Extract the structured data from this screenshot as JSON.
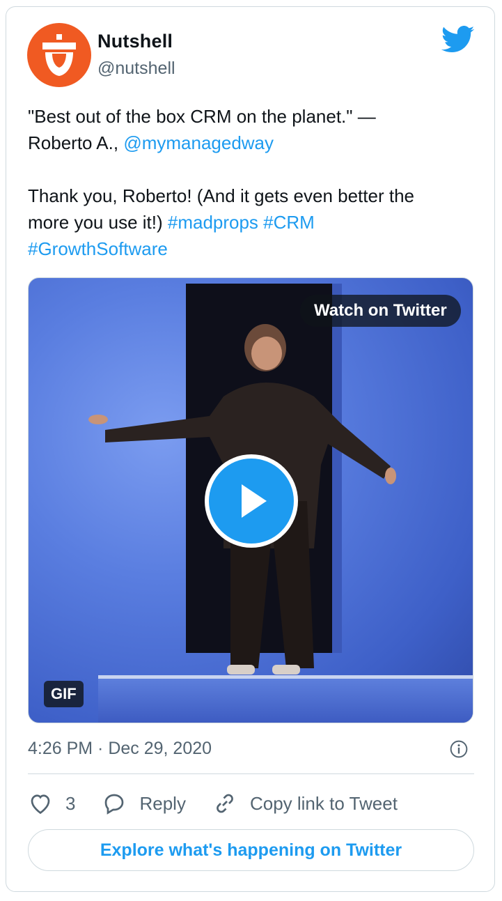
{
  "author": {
    "name": "Nutshell",
    "handle": "@nutshell",
    "avatar_icon": "acorn-logo-icon",
    "avatar_color": "#f05a22"
  },
  "tweet": {
    "line1": "\"Best out of the box CRM on the planet.\" —",
    "line2_prefix": "Roberto A., ",
    "mention": "@mymanagedway",
    "line3": "Thank you, Roberto! (And it gets even better the",
    "line4_prefix": "more you use it!) ",
    "hashtag1": "#madprops",
    "hashtag2": "#CRM",
    "hashtag3": "#GrowthSoftware"
  },
  "media": {
    "watch_label": "Watch on Twitter",
    "gif_badge": "GIF",
    "play_icon": "play-icon"
  },
  "meta": {
    "timestamp": "4:26 PM · Dec 29, 2020",
    "info_icon": "info-icon"
  },
  "actions": {
    "like_count": "3",
    "reply_label": "Reply",
    "copy_label": "Copy link to Tweet"
  },
  "explore_label": "Explore what's happening on Twitter",
  "colors": {
    "link": "#1d9bf0",
    "secondary_text": "#536471",
    "border": "#cfd9de"
  }
}
